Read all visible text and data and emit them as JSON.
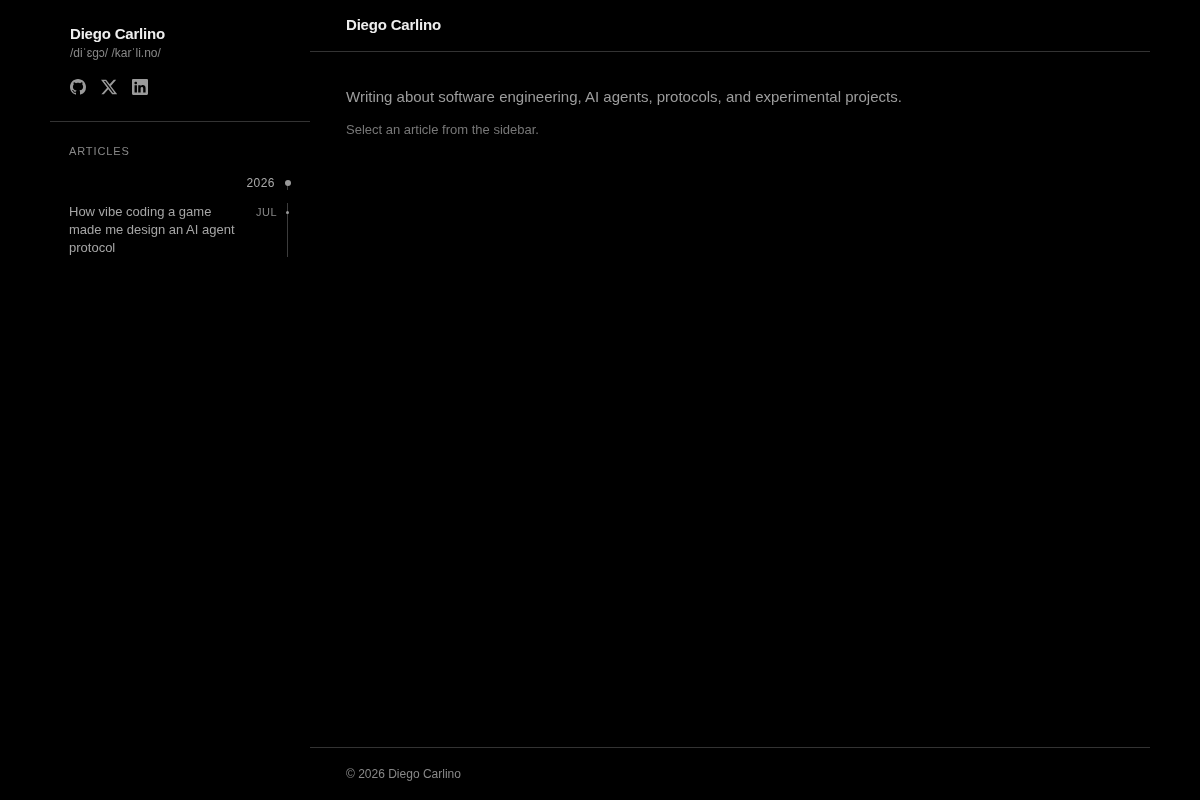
{
  "sidebar": {
    "name": "Diego Carlino",
    "pronunciation": "/diˈɛgɔ/ /karˈli.no/",
    "section_title": "ARTICLES",
    "timeline": [
      {
        "year": "2026",
        "months": [
          {
            "month": "JUL",
            "articles": [
              {
                "title": "How vibe coding a game made me design an AI agent protocol",
                "selected": false
              }
            ]
          }
        ]
      }
    ]
  },
  "header": {
    "title": "Diego Carlino"
  },
  "main": {
    "intro": "Writing about software engineering, AI agents, protocols, and experimental projects.",
    "hint": "Select an article from the sidebar."
  },
  "footer": {
    "copyright": "© 2026 Diego Carlino"
  }
}
